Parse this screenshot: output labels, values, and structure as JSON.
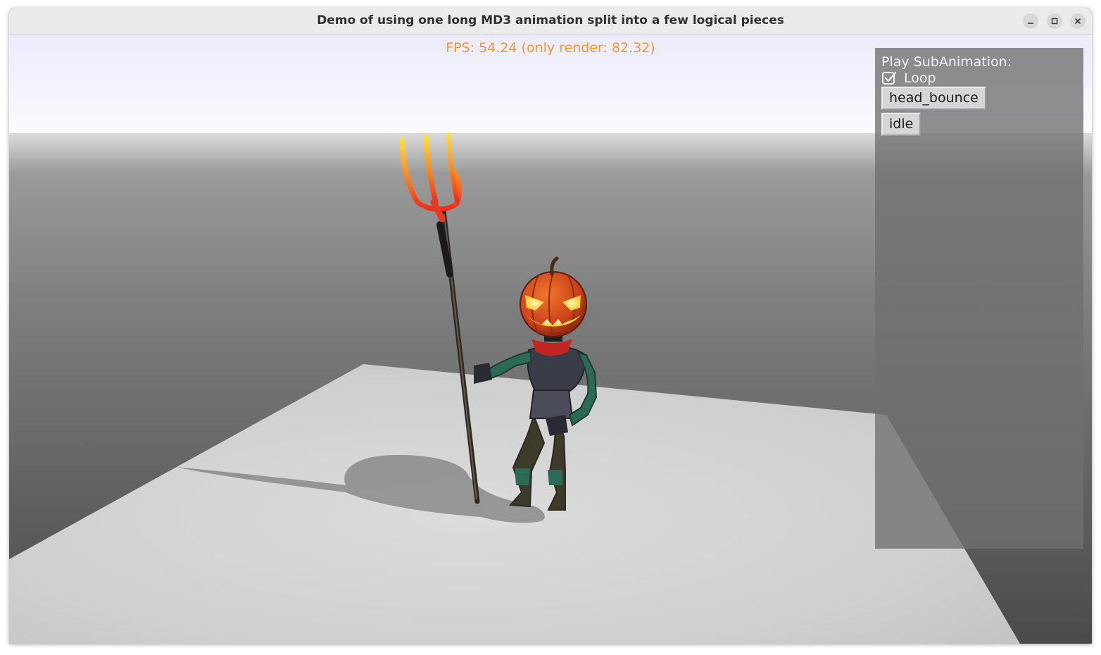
{
  "window": {
    "title": "Demo of using one long MD3 animation split into a few logical pieces",
    "controls": [
      "minimize-icon",
      "maximize-icon",
      "close-icon"
    ]
  },
  "viewport": {
    "fps_text": "FPS: 54.24 (only render: 82.32)"
  },
  "panel": {
    "title": "Play SubAnimation:",
    "loop": {
      "label": "Loop",
      "checked": true
    },
    "buttons": [
      {
        "label": "head_bounce"
      },
      {
        "label": "idle"
      }
    ]
  },
  "colors": {
    "fps_text": "#f5962f",
    "panel_bg": "#707070",
    "button_bg": "#d6d6d6",
    "sky": "#ffffff",
    "wall": "#6e6e6e",
    "floor": "#cfcfcf"
  }
}
